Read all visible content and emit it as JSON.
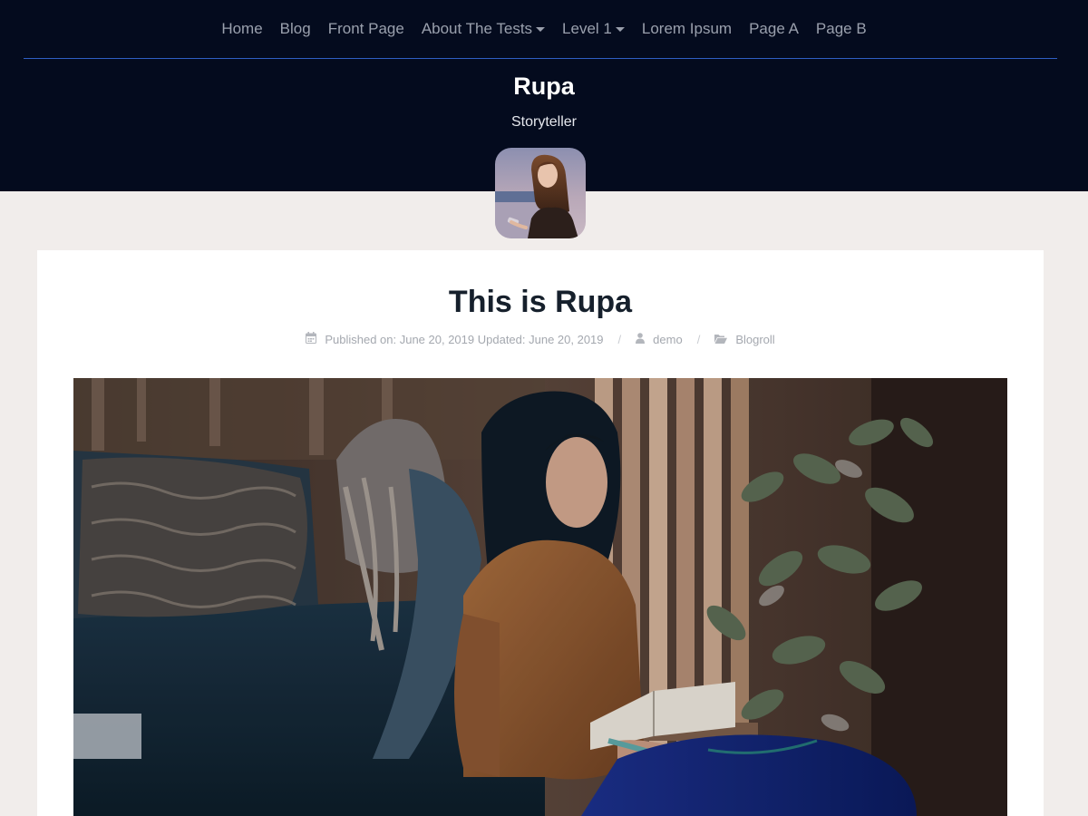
{
  "nav": {
    "items": [
      {
        "label": "Home",
        "dropdown": false
      },
      {
        "label": "Blog",
        "dropdown": false
      },
      {
        "label": "Front Page",
        "dropdown": false
      },
      {
        "label": "About The Tests",
        "dropdown": true
      },
      {
        "label": "Level 1",
        "dropdown": true
      },
      {
        "label": "Lorem Ipsum",
        "dropdown": false
      },
      {
        "label": "Page A",
        "dropdown": false
      },
      {
        "label": "Page B",
        "dropdown": false
      }
    ]
  },
  "site": {
    "title": "Rupa",
    "tagline": "Storyteller",
    "avatar_icon": "profile-photo"
  },
  "post": {
    "title": "This is Rupa",
    "meta": {
      "published": "Published on: June 20, 2019 Updated: June 20, 2019",
      "author": "demo",
      "category": "Blogroll",
      "separator": "/",
      "date_icon": "calendar-icon",
      "author_icon": "user-icon",
      "category_icon": "folder-open-icon"
    },
    "featured_image_icon": "woman-reading-photo"
  },
  "colors": {
    "header_bg": "#040b1e",
    "nav_text": "#9aa0ad",
    "nav_rule": "#2f5fc4",
    "page_bg": "#f1edeb",
    "title_text": "#16202c",
    "meta_text": "#a4a8af"
  }
}
